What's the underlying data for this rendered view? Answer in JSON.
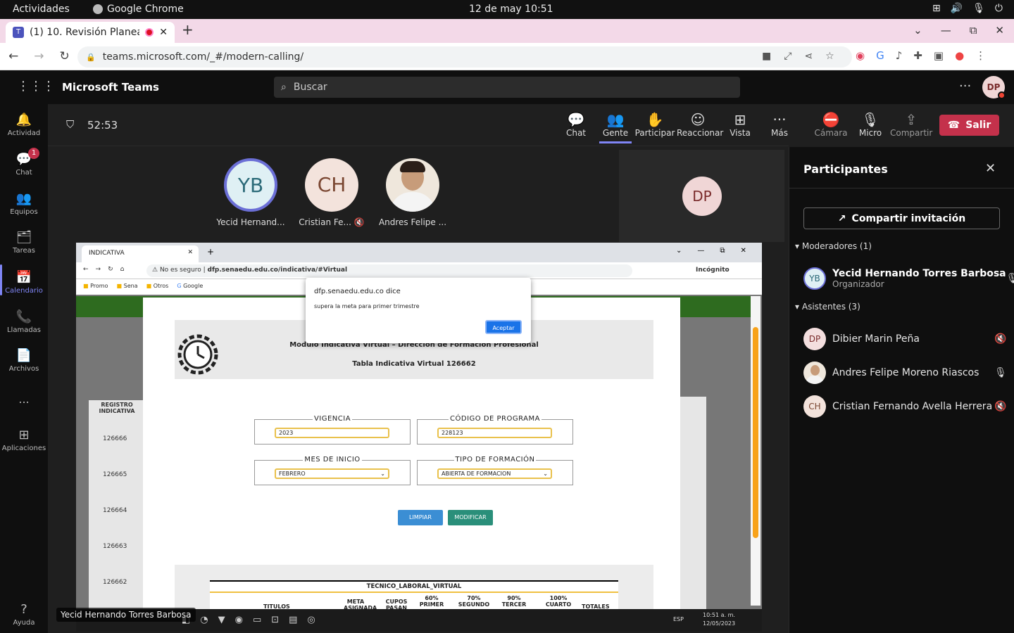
{
  "system": {
    "activities": "Actividades",
    "app": "Google Chrome",
    "clock": "12 de may  10:51"
  },
  "browser": {
    "tab_title": "(1) 10. Revisión Planea",
    "url": "teams.microsoft.com/_#/modern-calling/"
  },
  "teams": {
    "title": "Microsoft Teams",
    "search_placeholder": "Buscar",
    "my_initials": "DP"
  },
  "appbar": {
    "items": [
      {
        "label": "Actividad"
      },
      {
        "label": "Chat",
        "badge": "1"
      },
      {
        "label": "Equipos"
      },
      {
        "label": "Tareas"
      },
      {
        "label": "Calendario"
      },
      {
        "label": "Llamadas"
      },
      {
        "label": "Archivos"
      },
      {
        "label": "..."
      },
      {
        "label": "Aplicaciones"
      },
      {
        "label": "Ayuda"
      }
    ]
  },
  "meeting": {
    "timer": "52:53",
    "toolbar": {
      "chat": "Chat",
      "people": "Gente",
      "raise": "Participar",
      "react": "Reaccionar",
      "view": "Vista",
      "more": "Más",
      "camera": "Cámara",
      "mic": "Micro",
      "share": "Compartir",
      "leave": "Salir"
    },
    "tiles": [
      {
        "initials": "YB",
        "name": "Yecid Hernand..."
      },
      {
        "initials": "CH",
        "name": "Cristian Fe..."
      },
      {
        "initials": "",
        "name": "Andres Felipe ..."
      }
    ],
    "self_initials": "DP",
    "presenter_label": "Yecid Hernando Torres Barbosa"
  },
  "shared_screen": {
    "tab": "INDICATIVA",
    "insecure": "No es seguro",
    "url": "dfp.senaedu.edu.co/indicativa/#Virtual",
    "incognito": "Incógnito",
    "bookmarks": [
      "Promo",
      "Sena",
      "Otros",
      "Google"
    ],
    "dialog": {
      "origin": "dfp.senaedu.edu.co dice",
      "message": "supera la meta para primer trimestre",
      "ok": "Aceptar"
    },
    "header_line1": "Modulo Indicativa Virtual – Dirección de Formación Profesional",
    "header_line2": "Tabla Indicativa Virtual 126662",
    "form": {
      "vigencia_label": "VIGENCIA",
      "vigencia_value": "2023",
      "codigo_label": "CÓDIGO DE PROGRAMA",
      "codigo_value": "228123",
      "mes_label": "MES DE INICIO",
      "mes_value": "FEBRERO",
      "tipo_label": "TIPO DE FORMACIÓN",
      "tipo_value": "ABIERTA DE FORMACION"
    },
    "buttons": {
      "clear": "LIMPIAR",
      "modify": "MODIFICAR"
    },
    "left_panel": {
      "header": "REGISTRO INDICATIVA",
      "rows": [
        "126666",
        "126665",
        "126664",
        "126663",
        "126662"
      ]
    },
    "table": {
      "title": "TECNICO_LABORAL_VIRTUAL",
      "cols": [
        "TITULOS",
        "META ASIGNADA",
        "CUPOS PASAN",
        "60% PRIMER",
        "70% SEGUNDO",
        "90% TERCER",
        "100% CUARTO",
        "TOTALES"
      ]
    },
    "taskbar": {
      "time": "10:51 a. m.",
      "date": "12/05/2023",
      "lang": "ESP"
    }
  },
  "participants": {
    "title": "Participantes",
    "invite": "Compartir invitación",
    "moderators_header": "Moderadores (1)",
    "moderators": [
      {
        "initials": "YB",
        "name": "Yecid Hernando Torres Barbosa",
        "role": "Organizador"
      }
    ],
    "attendees_header": "Asistentes (3)",
    "attendees": [
      {
        "initials": "DP",
        "name": "Dibier Marin Peña"
      },
      {
        "initials": "",
        "name": "Andres Felipe Moreno Riascos"
      },
      {
        "initials": "CH",
        "name": "Cristian Fernando Avella Herrera"
      }
    ]
  }
}
